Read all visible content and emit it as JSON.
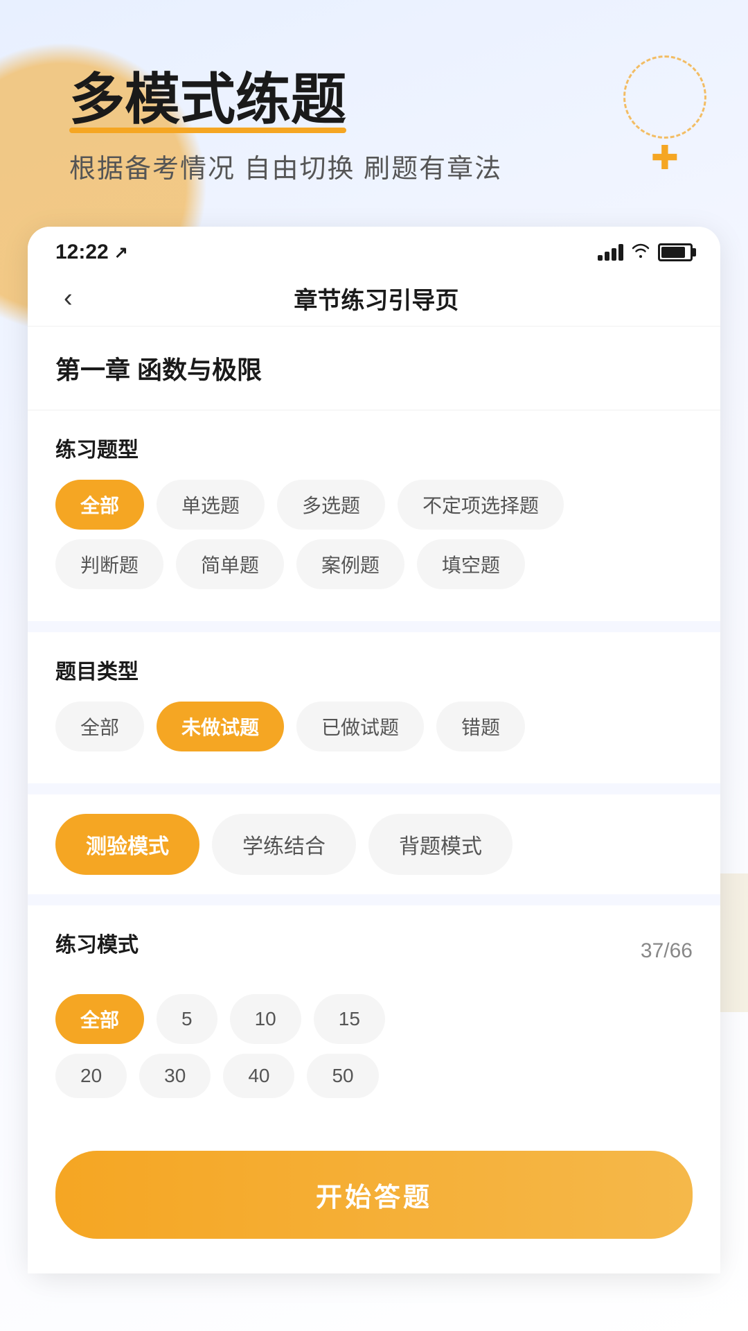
{
  "background": {
    "accentColor": "#f5a623",
    "crossSymbol": "✚"
  },
  "statusBar": {
    "time": "12:22",
    "locationIcon": "↗"
  },
  "navBar": {
    "backIcon": "‹",
    "title": "章节练习引导页"
  },
  "header": {
    "mainTitle": "多模式练题",
    "subtitle": "根据备考情况 自由切换 刷题有章法"
  },
  "chapterSection": {
    "title": "第一章 函数与极限"
  },
  "questionTypeSection": {
    "label": "练习题型",
    "tags": [
      {
        "id": "all",
        "label": "全部",
        "active": true
      },
      {
        "id": "single",
        "label": "单选题",
        "active": false
      },
      {
        "id": "multi",
        "label": "多选题",
        "active": false
      },
      {
        "id": "uncertain",
        "label": "不定项选择题",
        "active": false
      },
      {
        "id": "judge",
        "label": "判断题",
        "active": false
      },
      {
        "id": "simple",
        "label": "简单题",
        "active": false
      },
      {
        "id": "case",
        "label": "案例题",
        "active": false
      },
      {
        "id": "blank",
        "label": "填空题",
        "active": false
      }
    ]
  },
  "questionCategorySection": {
    "label": "题目类型",
    "tags": [
      {
        "id": "all",
        "label": "全部",
        "active": false
      },
      {
        "id": "undone",
        "label": "未做试题",
        "active": true
      },
      {
        "id": "done",
        "label": "已做试题",
        "active": false
      },
      {
        "id": "wrong",
        "label": "错题",
        "active": false
      }
    ]
  },
  "modeSection": {
    "modes": [
      {
        "id": "test",
        "label": "测验模式",
        "active": true
      },
      {
        "id": "study",
        "label": "学练结合",
        "active": false
      },
      {
        "id": "recite",
        "label": "背题模式",
        "active": false
      }
    ]
  },
  "practiceModeSection": {
    "label": "练习模式",
    "count": "37/66",
    "countOptions": [
      {
        "id": "all",
        "label": "全部",
        "active": true
      },
      {
        "id": "5",
        "label": "5",
        "active": false
      },
      {
        "id": "10",
        "label": "10",
        "active": false
      },
      {
        "id": "15",
        "label": "15",
        "active": false
      },
      {
        "id": "20",
        "label": "20",
        "active": false
      },
      {
        "id": "30",
        "label": "30",
        "active": false
      },
      {
        "id": "40",
        "label": "40",
        "active": false
      },
      {
        "id": "50",
        "label": "50",
        "active": false
      }
    ]
  },
  "startButton": {
    "label": "开始答题"
  }
}
